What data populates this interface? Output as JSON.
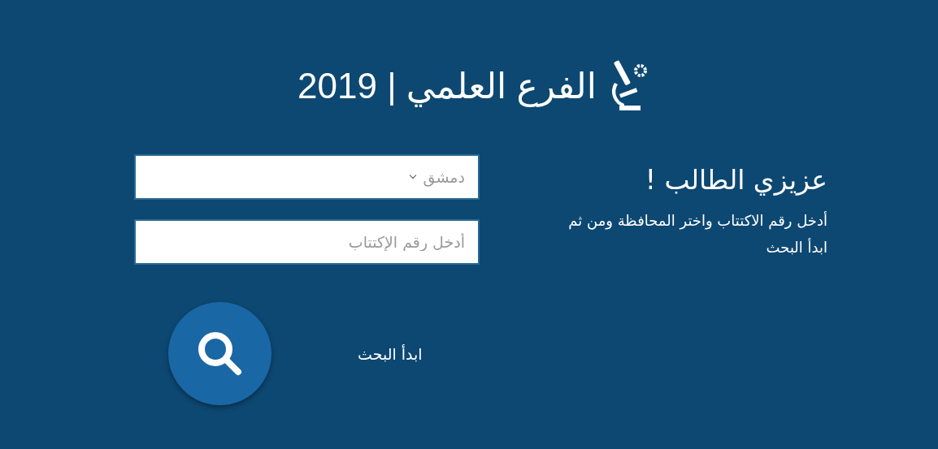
{
  "header": {
    "title": "الفرع العلمي | 2019"
  },
  "form": {
    "province": {
      "value": "دمشق"
    },
    "registration": {
      "placeholder": "أدخل رقم الإكتتاب"
    },
    "search_label": "ابدأ البحث"
  },
  "intro": {
    "heading": "عزيزي الطالب !",
    "text": "أدخل رقم الاكتتاب واختر المحافظة ومن ثم ابدأ البحث"
  }
}
